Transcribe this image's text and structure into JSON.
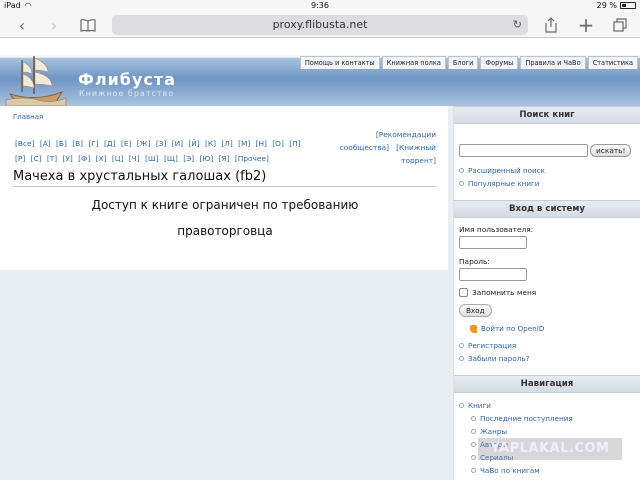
{
  "status_bar": {
    "device": "iPad",
    "time": "9:36",
    "battery": "29 %"
  },
  "browser": {
    "url": "proxy.flibusta.net"
  },
  "site": {
    "title": "Флибуста",
    "slogan": "Книжное братство",
    "tabs": [
      "Помощь и контакты",
      "Книжная полка",
      "Блоги",
      "Форумы",
      "Правила и ЧаВо",
      "Статистика"
    ]
  },
  "main": {
    "breadcrumb": "Главная",
    "alphabet": [
      "[Все]",
      "[А]",
      "[Б]",
      "[В]",
      "[Г]",
      "[Д]",
      "[Е]",
      "[Ж]",
      "[З]",
      "[И]",
      "[Й]",
      "[К]",
      "[Л]",
      "[М]",
      "[Н]",
      "[О]",
      "[П]",
      "[Р]",
      "[С]",
      "[Т]",
      "[У]",
      "[Ф]",
      "[Х]",
      "[Ц]",
      "[Ч]",
      "[Ш]",
      "[Щ]",
      "[Э]",
      "[Ю]",
      "[Я]",
      "[Прочее]"
    ],
    "recs_line1": "[Рекомендации",
    "recs_line2": "сообщества]",
    "recs_line3": "[Книжный",
    "recs_line4": "торрент]",
    "book_title": "Мачеха в хрустальных галошах (fb2)",
    "message_line1": "Доступ к книге ограничен по требованию",
    "message_line2": "правоторговца"
  },
  "sidebar": {
    "search": {
      "title": "Поиск книг",
      "button": "искать!",
      "advanced": "Расширенный поиск",
      "popular": "Популярные книги"
    },
    "login": {
      "title": "Вход в систему",
      "username_label": "Имя пользователя:",
      "password_label": "Пароль:",
      "remember": "Запомнить меня",
      "button": "Вход",
      "openid": "Войти по OpenID",
      "register": "Регистрация",
      "forgot": "Забыли пароль?"
    },
    "nav": {
      "title": "Навигация",
      "books": "Книги",
      "items": [
        "Последние поступления",
        "Жанры",
        "Авторы",
        "Сериалы",
        "ЧаВо по книгам"
      ]
    }
  },
  "watermark": "YAPLAKAL.COM"
}
